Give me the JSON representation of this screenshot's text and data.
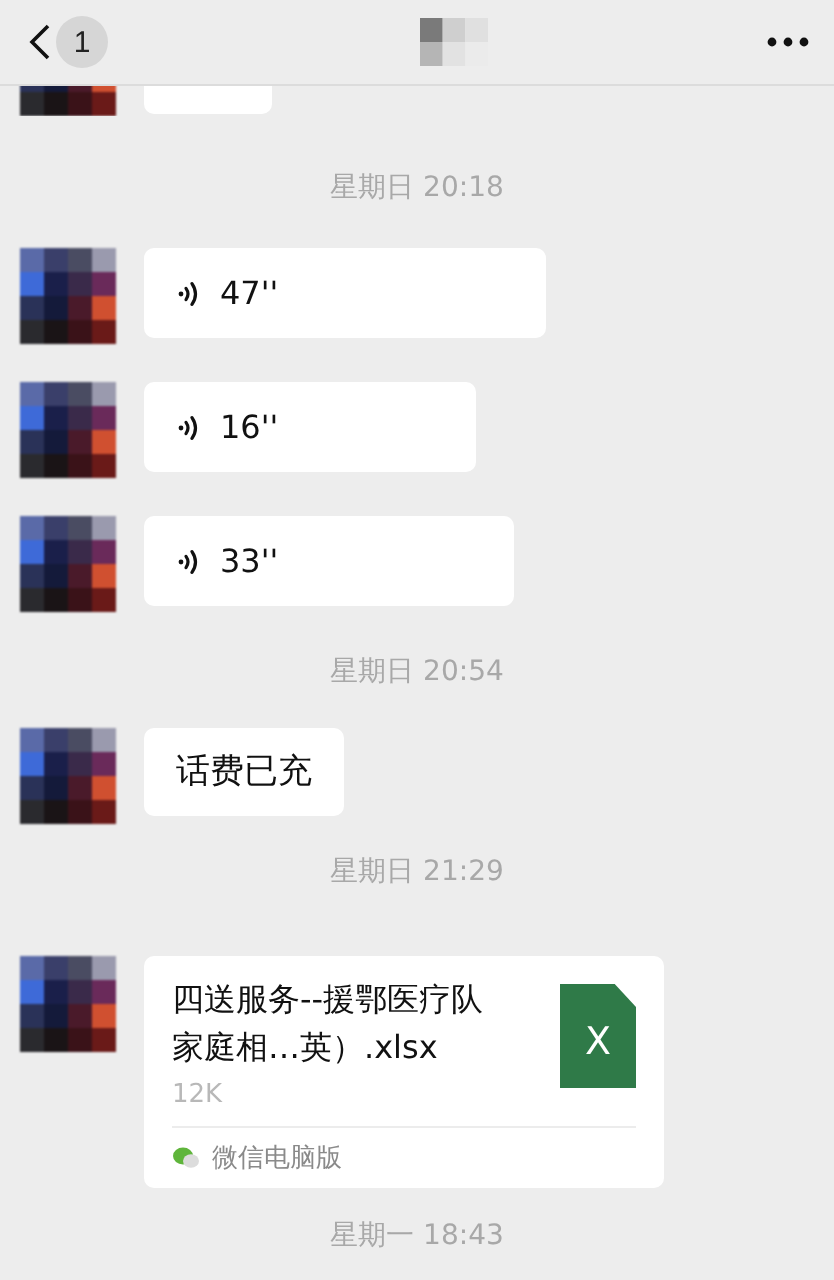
{
  "header": {
    "unread_count": "1"
  },
  "messages": [
    {
      "kind": "cut"
    },
    {
      "kind": "time",
      "text": "星期日 20:18"
    },
    {
      "kind": "voice",
      "duration": "47''"
    },
    {
      "kind": "voice",
      "duration": "16''"
    },
    {
      "kind": "voice",
      "duration": "33''"
    },
    {
      "kind": "time",
      "text": "星期日 20:54"
    },
    {
      "kind": "text",
      "text": "话费已充"
    },
    {
      "kind": "time",
      "text": "星期日 21:29"
    },
    {
      "kind": "file",
      "name": "四送服务--援鄂医疗队家庭相…英）.xlsx",
      "size": "12K",
      "icon_label": "X",
      "source": "微信电脑版"
    },
    {
      "kind": "time",
      "text": "星期一 18:43"
    }
  ]
}
